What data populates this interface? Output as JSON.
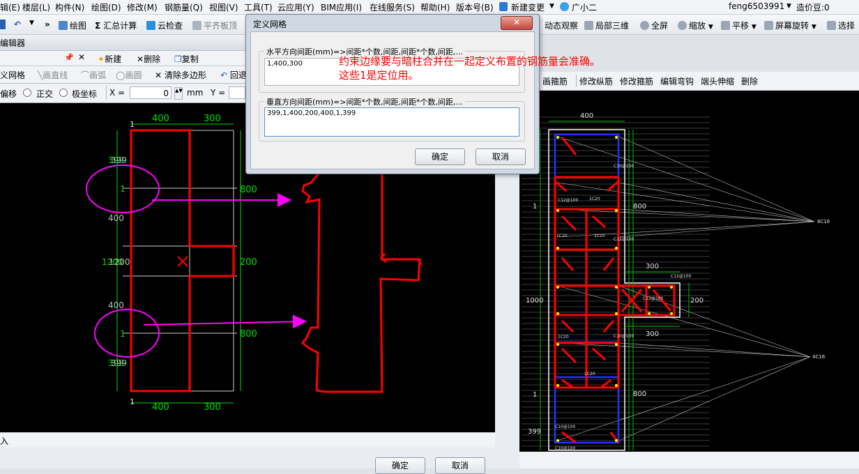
{
  "menu": {
    "items": [
      "辑(E)",
      "楼层(L)",
      "构件(N)",
      "绘图(D)",
      "修改(M)",
      "钢筋量(Q)",
      "视图(V)",
      "工具(T)",
      "云应用(Y)",
      "BIM应用(I)",
      "在线服务(S)",
      "帮助(H)",
      "版本号(B)",
      "新建变更",
      "广小二"
    ],
    "user": "feng6503991",
    "price": "造价豆:0"
  },
  "toolbar": {
    "draw": "绘图",
    "sum": "汇总计算",
    "cloud_check": "云检查",
    "flat_board": "平齐板顶",
    "dynamic": "动态观察",
    "local3d": "局部三维",
    "fullscreen": "全屏",
    "zoom": "缩放",
    "pan": "平移",
    "rotate": "屏幕旋转",
    "select": "选择"
  },
  "editor": {
    "title": "编辑器",
    "tools": {
      "define_grid": "义网格",
      "line": "画直线",
      "arc": "画弧",
      "circle": "画圆",
      "clear_poly": "清除多边形",
      "back": "回退"
    },
    "toolbar2": {
      "new": "新建",
      "delete": "删除",
      "copy": "复制"
    },
    "coords": {
      "offset": "偏移",
      "ortho": "正交",
      "polar": "极坐标",
      "x_label": "X =",
      "x_value": "0",
      "unit": "mm",
      "y_label": "Y ="
    },
    "status_text": "入",
    "ok": "确定",
    "cancel": "取消"
  },
  "left_drawing": {
    "top_dims": [
      "400",
      "300"
    ],
    "bottom_dims": [
      "400",
      "300"
    ],
    "left_dims": [
      "399",
      "1",
      "400",
      "1200",
      "400",
      "1",
      "399"
    ],
    "right_dims": [
      "800",
      "200",
      "800"
    ],
    "overlap_labels": [
      "399",
      "1200",
      "399"
    ],
    "corner_marks": [
      "1",
      "1"
    ]
  },
  "right_panel": {
    "tools": [
      "画箍筋",
      "修改纵筋",
      "修改箍筋",
      "编辑弯钩",
      "端头伸缩",
      "删除"
    ],
    "dims": {
      "top": "400",
      "right_upper": "800",
      "flange_top": "300",
      "flange_right": "200",
      "flange_bottom": "300",
      "left_mid": "1000",
      "left_small_top": "1",
      "left_small_bottom": "1",
      "right_lower": "800",
      "bottom_left": "399"
    },
    "rebar_labels": [
      "C10@100",
      "1C20",
      "1C20",
      "1C20",
      "1C20",
      "C12@100",
      "C12@100",
      "C12@100",
      "C12@100",
      "C10@100",
      "C10@100",
      "1C20",
      "C10@100"
    ],
    "callouts": [
      "8C16",
      "4C16"
    ]
  },
  "dialog": {
    "title": "定义网格",
    "close": "✕",
    "horizontal_label": "水平方向间距(mm)=>间距*个数,间距,间距*个数,间距,...",
    "horizontal_value": "1,400,300",
    "vertical_label": "垂直方向间距(mm)=>间距*个数,间距,间距*个数,间距,...",
    "vertical_value": "399,1,400,200,400,1,399",
    "ok": "确定",
    "cancel": "取消"
  },
  "annotation": {
    "line1": "约束边缘要与暗柱合并在一起定义布置的钢筋量会准确。",
    "line2": "这些1是定位用。"
  },
  "colors": {
    "annotation": "#ff0000",
    "dims": "#00e000",
    "magenta": "#ff00ff",
    "rebar": "#ff0000",
    "stirrup_blue": "#2233ff"
  }
}
